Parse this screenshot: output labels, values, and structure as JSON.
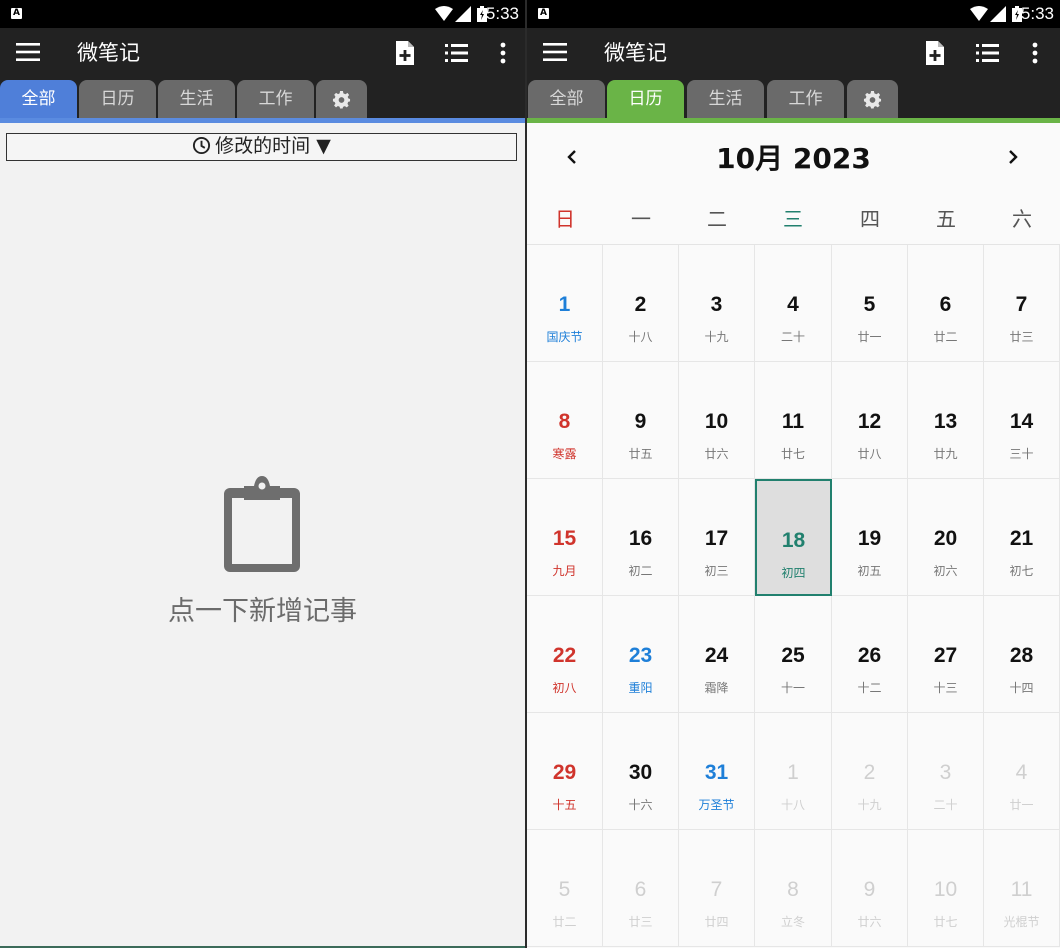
{
  "status": {
    "time": "5:33",
    "badge": "A"
  },
  "toolbar": {
    "title": "微笔记"
  },
  "tabs": [
    "全部",
    "日历",
    "生活",
    "工作"
  ],
  "left": {
    "sort_label": "修改的时间 ▼",
    "empty_text": "点一下新增记事"
  },
  "calendar": {
    "month_title": "10月 2023",
    "weekdays": [
      "日",
      "一",
      "二",
      "三",
      "四",
      "五",
      "六"
    ],
    "days": [
      {
        "d": "1",
        "l": "国庆节"
      },
      {
        "d": "2",
        "l": "十八"
      },
      {
        "d": "3",
        "l": "十九"
      },
      {
        "d": "4",
        "l": "二十"
      },
      {
        "d": "5",
        "l": "廿一"
      },
      {
        "d": "6",
        "l": "廿二"
      },
      {
        "d": "7",
        "l": "廿三"
      },
      {
        "d": "8",
        "l": "寒露"
      },
      {
        "d": "9",
        "l": "廿五"
      },
      {
        "d": "10",
        "l": "廿六"
      },
      {
        "d": "11",
        "l": "廿七"
      },
      {
        "d": "12",
        "l": "廿八"
      },
      {
        "d": "13",
        "l": "廿九"
      },
      {
        "d": "14",
        "l": "三十"
      },
      {
        "d": "15",
        "l": "九月"
      },
      {
        "d": "16",
        "l": "初二"
      },
      {
        "d": "17",
        "l": "初三"
      },
      {
        "d": "18",
        "l": "初四"
      },
      {
        "d": "19",
        "l": "初五"
      },
      {
        "d": "20",
        "l": "初六"
      },
      {
        "d": "21",
        "l": "初七"
      },
      {
        "d": "22",
        "l": "初八"
      },
      {
        "d": "23",
        "l": "重阳"
      },
      {
        "d": "24",
        "l": "霜降"
      },
      {
        "d": "25",
        "l": "十一"
      },
      {
        "d": "26",
        "l": "十二"
      },
      {
        "d": "27",
        "l": "十三"
      },
      {
        "d": "28",
        "l": "十四"
      },
      {
        "d": "29",
        "l": "十五"
      },
      {
        "d": "30",
        "l": "十六"
      },
      {
        "d": "31",
        "l": "万圣节"
      },
      {
        "d": "1",
        "l": "十八"
      },
      {
        "d": "2",
        "l": "十九"
      },
      {
        "d": "3",
        "l": "二十"
      },
      {
        "d": "4",
        "l": "廿一"
      },
      {
        "d": "5",
        "l": "廿二"
      },
      {
        "d": "6",
        "l": "廿三"
      },
      {
        "d": "7",
        "l": "廿四"
      },
      {
        "d": "8",
        "l": "立冬"
      },
      {
        "d": "9",
        "l": "廿六"
      },
      {
        "d": "10",
        "l": "廿七"
      },
      {
        "d": "11",
        "l": "光棍节"
      }
    ],
    "today_index": 17,
    "holiday_indices": [
      0,
      22,
      30
    ],
    "first_other_index": 31
  },
  "colors": {
    "tab_active_all": "#4f7fd9",
    "tab_active_calendar": "#6ab447",
    "today": "#21806e",
    "sunday": "#d0342c",
    "holiday": "#1e7fd8"
  }
}
